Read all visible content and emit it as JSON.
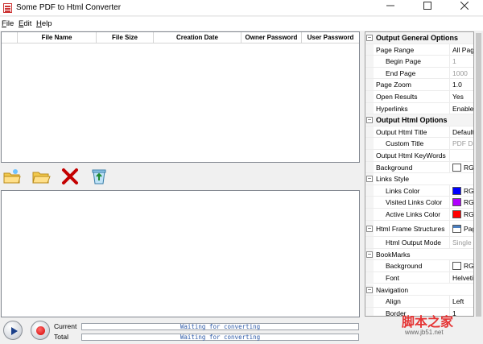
{
  "window": {
    "title": "Some PDF to Html Converter",
    "controls": [
      "minimize",
      "maximize",
      "close"
    ]
  },
  "menu": [
    {
      "label": "File",
      "underline": "F"
    },
    {
      "label": "Edit",
      "underline": "E"
    },
    {
      "label": "Help",
      "underline": "H"
    }
  ],
  "file_table": {
    "columns": [
      "File Name",
      "File Size",
      "Creation Date",
      "Owner Password",
      "User Password"
    ],
    "rows": []
  },
  "toolbar": {
    "buttons": [
      {
        "name": "add-file-icon"
      },
      {
        "name": "open-folder-icon"
      },
      {
        "name": "remove-icon"
      },
      {
        "name": "recycle-icon"
      }
    ]
  },
  "progress": {
    "current_label": "Current",
    "total_label": "Total",
    "current_text": "Waiting for converting",
    "total_text": "Waiting for converting"
  },
  "properties": [
    {
      "type": "category",
      "label": "Output General Options"
    },
    {
      "type": "prop",
      "label": "Page Range",
      "value": "All Pages",
      "indent": 0
    },
    {
      "type": "prop",
      "label": "Begin Page",
      "value": "1",
      "indent": 1,
      "grey": true
    },
    {
      "type": "prop",
      "label": "End Page",
      "value": "1000",
      "indent": 1,
      "grey": true
    },
    {
      "type": "prop",
      "label": "Page Zoom",
      "value": "1.0",
      "indent": 0
    },
    {
      "type": "prop",
      "label": "Open Results",
      "value": "Yes",
      "indent": 0
    },
    {
      "type": "prop",
      "label": "Hyperlinks",
      "value": "Enable",
      "indent": 0
    },
    {
      "type": "category",
      "label": "Output Html Options"
    },
    {
      "type": "prop",
      "label": "Output Html Title",
      "value": "Default",
      "indent": 0
    },
    {
      "type": "prop",
      "label": "Custom Title",
      "value": "PDF Document",
      "indent": 1,
      "grey": true
    },
    {
      "type": "prop",
      "label": "Output Html KeyWords",
      "value": "",
      "indent": 0
    },
    {
      "type": "prop",
      "label": "Background",
      "value": "RGB",
      "indent": 0,
      "swatch": "#ffffff"
    },
    {
      "type": "subcategory",
      "label": "Links Style"
    },
    {
      "type": "prop",
      "label": "Links Color",
      "value": "RGB",
      "indent": 1,
      "swatch": "#0000ff"
    },
    {
      "type": "prop",
      "label": "Visited Links Color",
      "value": "RGB",
      "indent": 1,
      "swatch": "#b000ff"
    },
    {
      "type": "prop",
      "label": "Active Links Color",
      "value": "RGB",
      "indent": 1,
      "swatch": "#ff0000"
    },
    {
      "type": "subcategory-tall",
      "label": "Html Frame Structures",
      "value": "Page"
    },
    {
      "type": "prop",
      "label": "Html Output Mode",
      "value": "Single Html",
      "indent": 1,
      "grey": true
    },
    {
      "type": "subcategory",
      "label": "BookMarks"
    },
    {
      "type": "prop",
      "label": "Background",
      "value": "RGB",
      "indent": 1,
      "swatch": "#ffffff"
    },
    {
      "type": "prop",
      "label": "Font",
      "value": "Helvetica",
      "indent": 1
    },
    {
      "type": "subcategory",
      "label": "Navigation"
    },
    {
      "type": "prop",
      "label": "Align",
      "value": "Left",
      "indent": 1
    },
    {
      "type": "prop",
      "label": "Border",
      "value": "1",
      "indent": 1
    }
  ],
  "watermark": {
    "main": "脚本之家",
    "sub": "www.jb51.net"
  }
}
